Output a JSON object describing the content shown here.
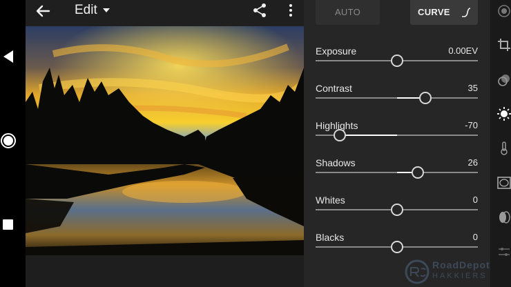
{
  "header": {
    "title": "Edit"
  },
  "tabs": {
    "auto_label": "AUTO",
    "curve_label": "CURVE"
  },
  "sliders": [
    {
      "name": "exposure",
      "label": "Exposure",
      "value": "0.00EV",
      "position": 0.5
    },
    {
      "name": "contrast",
      "label": "Contrast",
      "value": "35",
      "position": 0.675
    },
    {
      "name": "highlights",
      "label": "Highlights",
      "value": "-70",
      "position": 0.15
    },
    {
      "name": "shadows",
      "label": "Shadows",
      "value": "26",
      "position": 0.63
    },
    {
      "name": "whites",
      "label": "Whites",
      "value": "0",
      "position": 0.5
    },
    {
      "name": "blacks",
      "label": "Blacks",
      "value": "0",
      "position": 0.5
    }
  ],
  "watermark": {
    "line1": "RoadDepot",
    "line2": "HAKKIERS"
  },
  "colors": {
    "panel_bg": "#262626",
    "track": "#8a8a8a",
    "track_fill": "#ffffff",
    "thumb_border": "#d8d8d8"
  },
  "icons": {
    "nav_back": "triangle-left-icon",
    "nav_home": "circle-icon",
    "nav_recent": "square-icon",
    "back": "arrow-left-icon",
    "dropdown": "caret-down-icon",
    "share": "share-icon",
    "more": "more-vertical-icon",
    "curve": "curve-icon",
    "tools": [
      "presets-icon",
      "crop-icon",
      "healing-icon",
      "light-icon",
      "color-temp-icon",
      "effects-icon",
      "optics-icon",
      "detail-icon"
    ]
  }
}
